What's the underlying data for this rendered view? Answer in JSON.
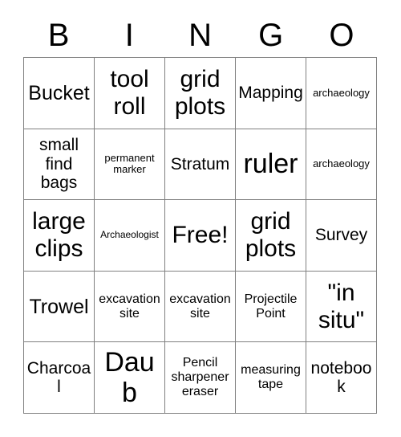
{
  "card": {
    "title": "BINGO",
    "header_letters": [
      "B",
      "I",
      "N",
      "G",
      "O"
    ],
    "colors": {
      "background": "#ffffff",
      "text": "#000000",
      "grid_line": "#808080"
    },
    "rows": [
      [
        {
          "text": "Bucket",
          "size": "lg"
        },
        {
          "text": "tool roll",
          "size": "xl"
        },
        {
          "text": "grid plots",
          "size": "xl"
        },
        {
          "text": "Mapping",
          "size": "md"
        },
        {
          "text": "archaeology",
          "size": "xs"
        }
      ],
      [
        {
          "text": "small find bags",
          "size": "md"
        },
        {
          "text": "permanent marker",
          "size": "xs"
        },
        {
          "text": "Stratum",
          "size": "md"
        },
        {
          "text": "ruler",
          "size": "xxl"
        },
        {
          "text": "archaeology",
          "size": "xs"
        }
      ],
      [
        {
          "text": "large clips",
          "size": "xl"
        },
        {
          "text": "Archaeologist",
          "size": "xxs"
        },
        {
          "text": "Free!",
          "size": "xl"
        },
        {
          "text": "grid plots",
          "size": "xl"
        },
        {
          "text": "Survey",
          "size": "md"
        }
      ],
      [
        {
          "text": "Trowel",
          "size": "lg"
        },
        {
          "text": "excavation site",
          "size": "sm"
        },
        {
          "text": "excavation site",
          "size": "sm"
        },
        {
          "text": "Projectile Point",
          "size": "sm"
        },
        {
          "text": "\"in situ\"",
          "size": "xl"
        }
      ],
      [
        {
          "text": "Charcoal",
          "size": "md"
        },
        {
          "text": "Daub",
          "size": "xxl"
        },
        {
          "text": "Pencil sharpener eraser",
          "size": "sm"
        },
        {
          "text": "measuring tape",
          "size": "sm"
        },
        {
          "text": "notebook",
          "size": "md"
        }
      ]
    ]
  }
}
